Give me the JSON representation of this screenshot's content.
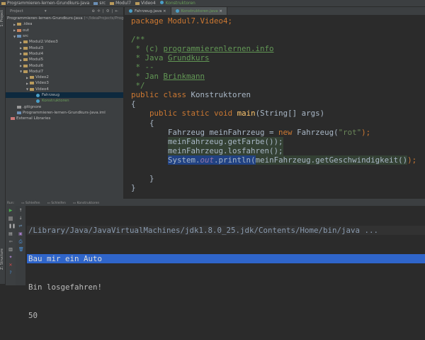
{
  "breadcrumb": [
    "Programmieren-lernen-Grundkurs-Java",
    "src",
    "Modul7",
    "Video4",
    "Konstruktoren"
  ],
  "sidebar": {
    "stripe_project": "1: Project",
    "stripe_structure": "Z: Structure",
    "panel_title": "Project",
    "root": "Programmieren-lernen-Grundkurs-Java",
    "root_path": "(~/IdeaProjects/Prog",
    "items": [
      {
        "label": ".idea",
        "depth": 1,
        "arrow": "▶"
      },
      {
        "label": "out",
        "depth": 1,
        "arrow": "▶"
      },
      {
        "label": "src",
        "depth": 1,
        "arrow": "▼"
      },
      {
        "label": "Modul2.Video3",
        "depth": 2,
        "arrow": "▶"
      },
      {
        "label": "Modul3",
        "depth": 2,
        "arrow": "▶"
      },
      {
        "label": "Modul4",
        "depth": 2,
        "arrow": "▶"
      },
      {
        "label": "Modul5",
        "depth": 2,
        "arrow": "▶"
      },
      {
        "label": "Modul6",
        "depth": 2,
        "arrow": "▶"
      },
      {
        "label": "Modul7",
        "depth": 2,
        "arrow": "▼"
      },
      {
        "label": "Video2",
        "depth": 3,
        "arrow": "▶"
      },
      {
        "label": "Video3",
        "depth": 3,
        "arrow": "▶"
      },
      {
        "label": "Video4",
        "depth": 3,
        "arrow": "▼"
      },
      {
        "label": "Fahrzeug",
        "depth": 4,
        "arrow": ""
      },
      {
        "label": "Konstruktoren",
        "depth": 4,
        "arrow": ""
      },
      {
        "label": ".gitignore",
        "depth": 1,
        "arrow": ""
      },
      {
        "label": "Programmieren-lernen-Grundkurs-Java.iml",
        "depth": 1,
        "arrow": ""
      },
      {
        "label": "External Libraries",
        "depth": 0,
        "arrow": ""
      }
    ]
  },
  "tabs": [
    "Fahrzeug.java",
    "Konstruktoren.java"
  ],
  "code": {
    "l0": "package Modul7.Video4;",
    "l2": "/**",
    "l3a": " * (c) ",
    "l3b": "programmierenlernen.info",
    "l4a": " * Java ",
    "l4b": "Grundkurs",
    "l5": " * --",
    "l6a": " * Jan ",
    "l6b": "Brinkmann",
    "l7": " */",
    "public": "public",
    "class": "class",
    "classname": " Konstruktoren",
    "static": "static",
    "void": "void",
    "main": "main",
    "main_args": "(String[] args)",
    "new": "new",
    "decl1": "Fahrzeug meinFahrzeug",
    "decl2": " = ",
    "ctor": " Fahrzeug(",
    "rot": "\"rot\"",
    "end": ");",
    "l13": "meinFahrzeug.getFarbe());",
    "l14": "meinFahrzeug.losfahren();",
    "sys": "System.",
    "out": "out",
    "println": ".println(",
    "arg": "meinFahrzeug.getGeschwindigkeit()",
    "close": ");"
  },
  "run": {
    "label": "Run:",
    "tabs": [
      "Schleifen",
      "Schleifen",
      "Konstruktoren"
    ],
    "console": [
      "/Library/Java/JavaVirtualMachines/jdk1.8.0_25.jdk/Contents/Home/bin/java ...",
      "Bau mir ein Auto",
      "Bin losgefahren!",
      "50"
    ]
  }
}
